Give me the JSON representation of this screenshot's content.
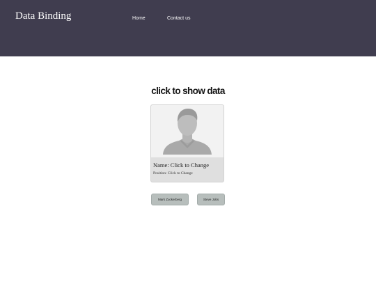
{
  "header": {
    "brand": "Data Binding",
    "nav": [
      {
        "label": "Home"
      },
      {
        "label": "Contact us"
      }
    ]
  },
  "main": {
    "title": "click to show data",
    "card": {
      "avatar_icon": "person-silhouette-icon",
      "name_text": "Name: Click to Change",
      "position_text": "Position: Click to Change"
    },
    "buttons": [
      {
        "label": "Mark Zuckerberg"
      },
      {
        "label": "Steve Jobs"
      }
    ]
  },
  "colors": {
    "header_bg": "#403d4f",
    "button_bg": "#b7bebc",
    "card_bg": "#dfdfdf"
  }
}
